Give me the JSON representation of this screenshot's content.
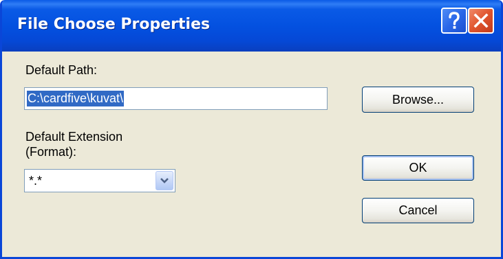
{
  "window": {
    "title": "File Choose Properties"
  },
  "titlebar": {
    "help_icon": "help-icon",
    "close_icon": "close-icon"
  },
  "form": {
    "path_label": "Default Path:",
    "path_value": "C:\\cardfive\\kuvat\\",
    "extension_label_line1": "Default Extension",
    "extension_label_line2": "(Format):",
    "extension_value": "*.*"
  },
  "buttons": {
    "browse": "Browse...",
    "ok": "OK",
    "cancel": "Cancel"
  },
  "colors": {
    "titlebar": "#0451e0",
    "dialog_bg": "#ece9d8",
    "selection": "#316ac5",
    "close_button": "#e0542d"
  }
}
